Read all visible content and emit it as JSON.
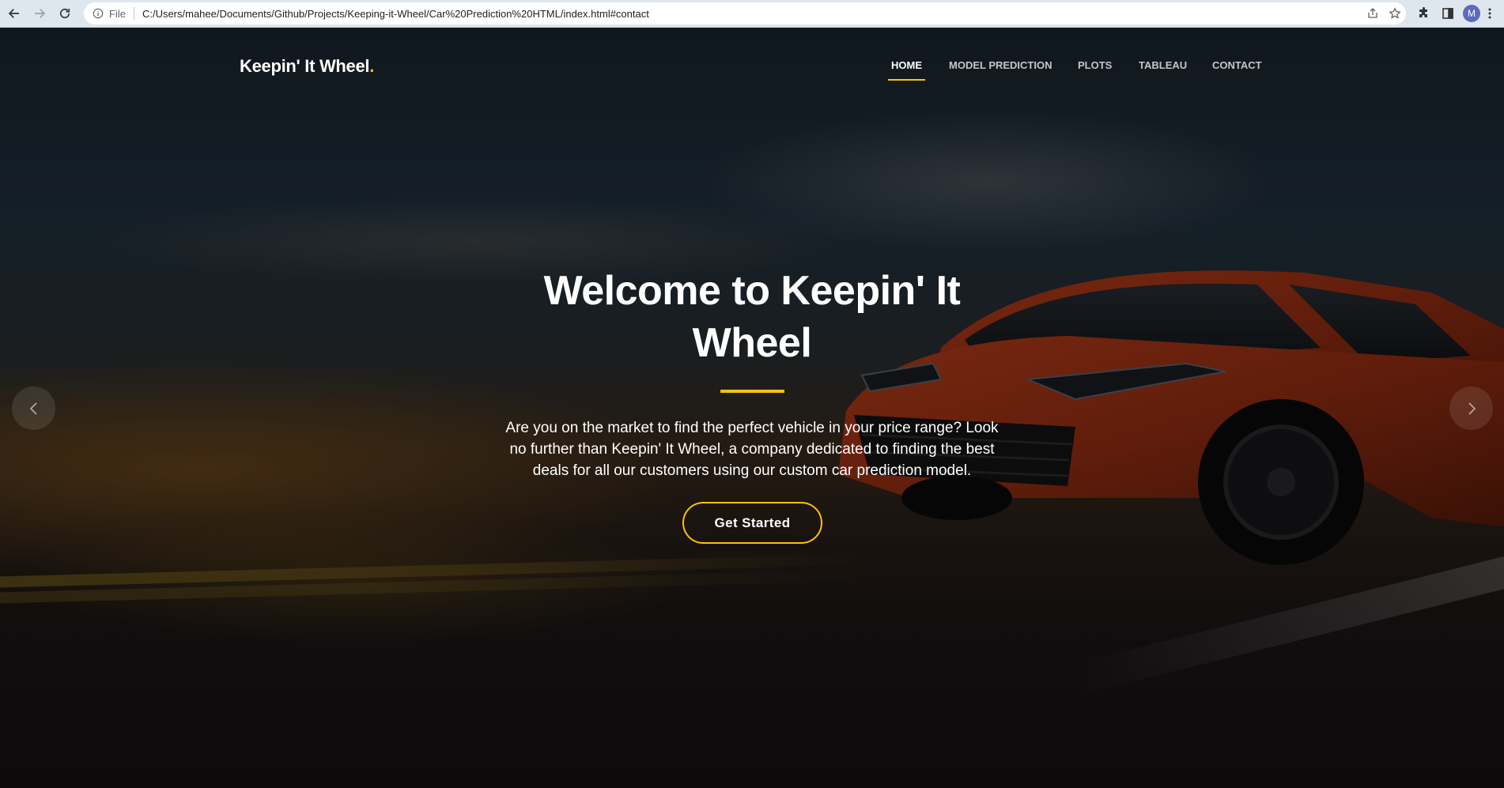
{
  "browser": {
    "file_label": "File",
    "url": "C:/Users/mahee/Documents/Github/Projects/Keeping-it-Wheel/Car%20Prediction%20HTML/index.html#contact",
    "profile_initial": "M",
    "icons": [
      "back-icon",
      "forward-icon",
      "reload-icon",
      "info-icon",
      "share-icon",
      "star-icon",
      "extensions-icon",
      "sidepanel-icon",
      "menu-icon"
    ]
  },
  "site": {
    "logo_text": "Keepin' It Wheel",
    "logo_dot": ".",
    "accent_color": "#ffc107",
    "nav": [
      {
        "label": "HOME",
        "active": true
      },
      {
        "label": "MODEL PREDICTION",
        "active": false
      },
      {
        "label": "PLOTS",
        "active": false
      },
      {
        "label": "TABLEAU",
        "active": false
      },
      {
        "label": "CONTACT",
        "active": false
      }
    ]
  },
  "hero": {
    "title_line1": "Welcome to Keepin' It",
    "title_line2": "Wheel",
    "text": "Are you on the market to find the perfect vehicle in your price range? Look no further than Keepin' It Wheel, a company dedicated to finding the best deals for all our customers using our custom car prediction model.",
    "cta_label": "Get Started",
    "prev_icon": "chevron-left-icon",
    "next_icon": "chevron-right-icon"
  }
}
